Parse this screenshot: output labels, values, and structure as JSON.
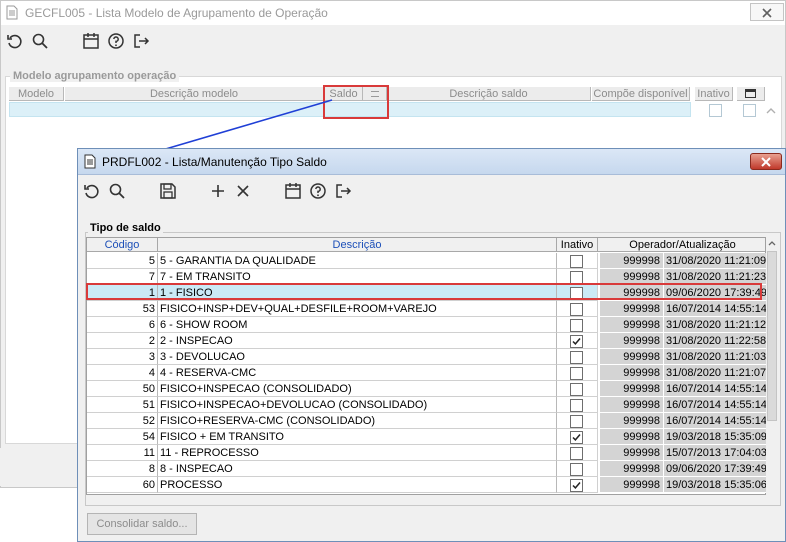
{
  "background_window": {
    "title": "GECFL005 - Lista Modelo de Agrupamento de Operação",
    "group_label": "Modelo agrupamento operação",
    "columns": [
      "Modelo",
      "Descrição modelo",
      "Saldo",
      "",
      "Descrição saldo",
      "Compõe disponível",
      "Inativo"
    ],
    "icons": [
      "refresh-icon",
      "search-icon",
      "calendar-icon",
      "help-icon",
      "exit-icon",
      "close-icon"
    ]
  },
  "dialog": {
    "title": "PRDFL002 - Lista/Manutenção Tipo Saldo",
    "group_label": "Tipo de saldo",
    "columns": {
      "codigo": "Código",
      "descricao": "Descrição",
      "inativo": "Inativo",
      "operador": "Operador/Atualização"
    },
    "rows": [
      {
        "codigo": "5",
        "descricao": "5 - GARANTIA DA QUALIDADE",
        "inativo": false,
        "operador": "999998",
        "atualizacao": "31/08/2020 11:21:09"
      },
      {
        "codigo": "7",
        "descricao": "7 - EM TRANSITO",
        "inativo": false,
        "operador": "999998",
        "atualizacao": "31/08/2020 11:21:23"
      },
      {
        "codigo": "1",
        "descricao": "1 - FISICO",
        "inativo": false,
        "operador": "999998",
        "atualizacao": "09/06/2020 17:39:49",
        "selected": true
      },
      {
        "codigo": "53",
        "descricao": "FISICO+INSP+DEV+QUAL+DESFILE+ROOM+VAREJO",
        "inativo": false,
        "operador": "999998",
        "atualizacao": "16/07/2014 14:55:14"
      },
      {
        "codigo": "6",
        "descricao": "6 - SHOW ROOM",
        "inativo": false,
        "operador": "999998",
        "atualizacao": "31/08/2020 11:21:12"
      },
      {
        "codigo": "2",
        "descricao": "2 - INSPECAO",
        "inativo": true,
        "operador": "999998",
        "atualizacao": "31/08/2020 11:22:58"
      },
      {
        "codigo": "3",
        "descricao": "3 - DEVOLUCAO",
        "inativo": false,
        "operador": "999998",
        "atualizacao": "31/08/2020 11:21:03"
      },
      {
        "codigo": "4",
        "descricao": "4 - RESERVA-CMC",
        "inativo": false,
        "operador": "999998",
        "atualizacao": "31/08/2020 11:21:07"
      },
      {
        "codigo": "50",
        "descricao": "FISICO+INSPECAO (CONSOLIDADO)",
        "inativo": false,
        "operador": "999998",
        "atualizacao": "16/07/2014 14:55:14"
      },
      {
        "codigo": "51",
        "descricao": "FISICO+INSPECAO+DEVOLUCAO (CONSOLIDADO)",
        "inativo": false,
        "operador": "999998",
        "atualizacao": "16/07/2014 14:55:14"
      },
      {
        "codigo": "52",
        "descricao": "FISICO+RESERVA-CMC (CONSOLIDADO)",
        "inativo": false,
        "operador": "999998",
        "atualizacao": "16/07/2014 14:55:14"
      },
      {
        "codigo": "54",
        "descricao": "FISICO + EM TRANSITO",
        "inativo": true,
        "operador": "999998",
        "atualizacao": "19/03/2018 15:35:09"
      },
      {
        "codigo": "11",
        "descricao": "11 - REPROCESSO",
        "inativo": false,
        "operador": "999998",
        "atualizacao": "15/07/2013 17:04:03"
      },
      {
        "codigo": "8",
        "descricao": "8 - INSPECAO",
        "inativo": false,
        "operador": "999998",
        "atualizacao": "09/06/2020 17:39:49"
      },
      {
        "codigo": "60",
        "descricao": "PROCESSO",
        "inativo": true,
        "operador": "999998",
        "atualizacao": "19/03/2018 15:35:06"
      }
    ],
    "consolidar_button": "Consolidar saldo...",
    "icons": [
      "refresh-icon",
      "search-icon",
      "save-icon",
      "add-icon",
      "delete-icon",
      "calendar-icon",
      "help-icon",
      "exit-icon",
      "close-icon"
    ]
  },
  "annotation": {
    "highlight_color": "#d93a3a",
    "arrow_color": "#1f3fd6"
  }
}
